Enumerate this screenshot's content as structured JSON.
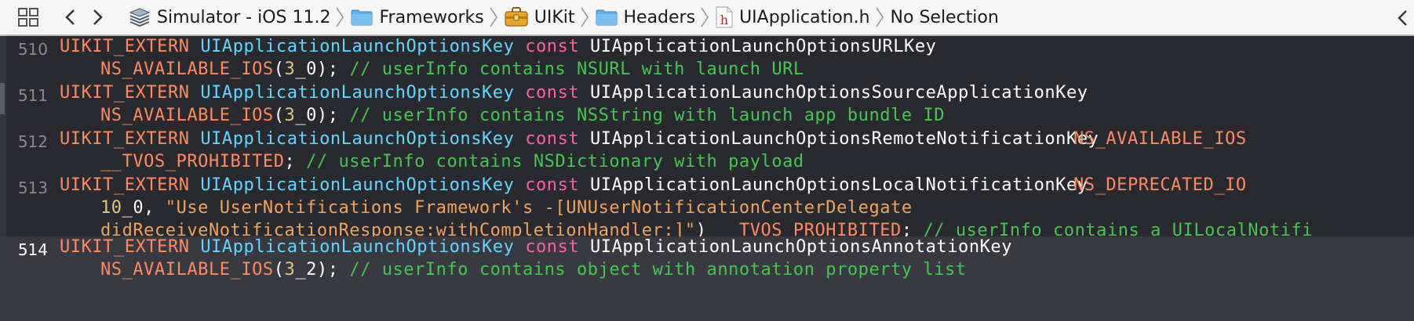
{
  "jump_bar": {
    "breadcrumbs": [
      {
        "label": "Simulator - iOS 11.2",
        "icon": "sdk-icon"
      },
      {
        "label": "Frameworks",
        "icon": "folder-icon"
      },
      {
        "label": "UIKit",
        "icon": "framework-toolbox-icon"
      },
      {
        "label": "Headers",
        "icon": "folder-icon"
      },
      {
        "label": "UIApplication.h",
        "icon": "header-file-icon"
      },
      {
        "label": "No Selection",
        "icon": ""
      }
    ]
  },
  "editor": {
    "current_line": "514",
    "lines": [
      {
        "number": "510",
        "l1": {
          "macro": "UIKIT_EXTERN",
          "type": "UIApplicationLaunchOptionsKey",
          "kw": "const",
          "name": "UIApplicationLaunchOptionsURLKey"
        },
        "l2": {
          "avail": "NS_AVAILABLE_IOS",
          "open": "(",
          "num": "3",
          "rest": "_0);",
          "comment": "// userInfo contains NSURL with launch URL"
        }
      },
      {
        "number": "511",
        "l1": {
          "macro": "UIKIT_EXTERN",
          "type": "UIApplicationLaunchOptionsKey",
          "kw": "const",
          "name": "UIApplicationLaunchOptionsSourceApplicationKey"
        },
        "l2": {
          "avail": "NS_AVAILABLE_IOS",
          "open": "(",
          "num": "3",
          "rest": "_0);",
          "comment": "// userInfo contains NSString with launch app bundle ID"
        }
      },
      {
        "number": "512",
        "l1": {
          "macro": "UIKIT_EXTERN",
          "type": "UIApplicationLaunchOptionsKey",
          "kw": "const",
          "name": "UIApplicationLaunchOptionsRemoteNotificationKey",
          "trail": "NS_AVAILABLE_IOS"
        },
        "l2": {
          "prohibited": "__TVOS_PROHIBITED",
          "semi": ";",
          "comment": "// userInfo contains NSDictionary with payload"
        }
      },
      {
        "number": "513",
        "l1": {
          "macro": "UIKIT_EXTERN",
          "type": "UIApplicationLaunchOptionsKey",
          "kw": "const",
          "name": "UIApplicationLaunchOptionsLocalNotificationKey",
          "trail": "NS_DEPRECATED_IO"
        },
        "l2": {
          "num": "10",
          "rest": "_0,",
          "string": "\"Use UserNotifications Framework's -[UNUserNotificationCenterDelegate"
        },
        "l3": {
          "string": "didReceiveNotificationResponse:withCompletionHandler:]\"",
          "close": ")",
          "prohibited": "__TVOS_PROHIBITED",
          "semi": ";",
          "comment": "// userInfo contains a UILocalNotifi"
        }
      },
      {
        "number": "514",
        "l1": {
          "macro": "UIKIT_EXTERN",
          "type": "UIApplicationLaunchOptionsKey",
          "kw": "const",
          "name": "UIApplicationLaunchOptionsAnnotationKey"
        },
        "l2": {
          "avail": "NS_AVAILABLE_IOS",
          "open": "(",
          "num": "3",
          "rest": "_2);",
          "comment": "// userInfo contains object with annotation property list"
        }
      }
    ]
  }
}
